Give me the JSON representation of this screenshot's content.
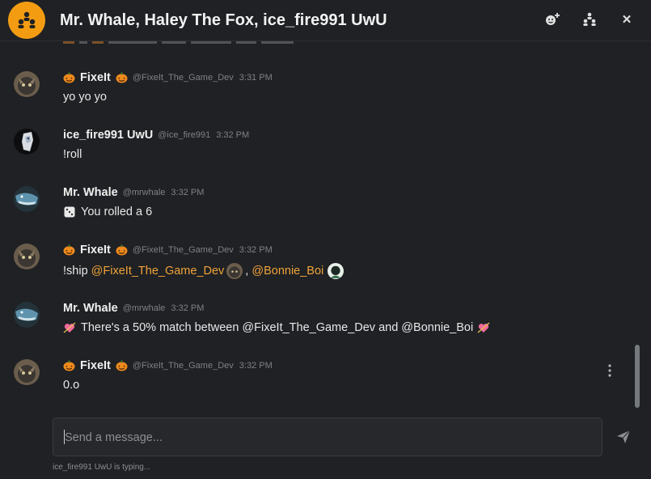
{
  "header": {
    "title": "Mr. Whale, Haley The Fox, ice_fire991 UwU",
    "icon": "group-people-icon",
    "actions": [
      {
        "name": "add-reaction-icon"
      },
      {
        "name": "members-icon"
      },
      {
        "name": "close-icon",
        "symbol": "✕"
      }
    ]
  },
  "messages": [
    {
      "name": "FixeIt",
      "handle": "@FixeIt_The_Game_Dev",
      "time": "3:31 PM",
      "text": "yo yo yo"
    },
    {
      "name": "ice_fire991 UwU",
      "handle": "@ice_fire991",
      "time": "3:32 PM",
      "text": "!roll"
    },
    {
      "name": "Mr. Whale",
      "handle": "@mrwhale",
      "time": "3:32 PM",
      "text": "You rolled a 6"
    },
    {
      "name": "FixeIt",
      "handle": "@FixeIt_The_Game_Dev",
      "time": "3:32 PM",
      "text_prefix": "!ship ",
      "mention1": "@FixeIt_The_Game_Dev",
      "separator": ", ",
      "mention2": "@Bonnie_Boi"
    },
    {
      "name": "Mr. Whale",
      "handle": "@mrwhale",
      "time": "3:32 PM",
      "text": "There's a 50% match between @FixeIt_The_Game_Dev and @Bonnie_Boi"
    },
    {
      "name": "FixeIt",
      "handle": "@FixeIt_The_Game_Dev",
      "time": "3:32 PM",
      "text": "0.o"
    }
  ],
  "composer": {
    "placeholder": "Send a message..."
  },
  "typing_indicator": "ice_fire991 UwU is typing...",
  "colors": {
    "accent": "#f39c12",
    "mention": "#f0a339",
    "background": "#1f2124"
  }
}
